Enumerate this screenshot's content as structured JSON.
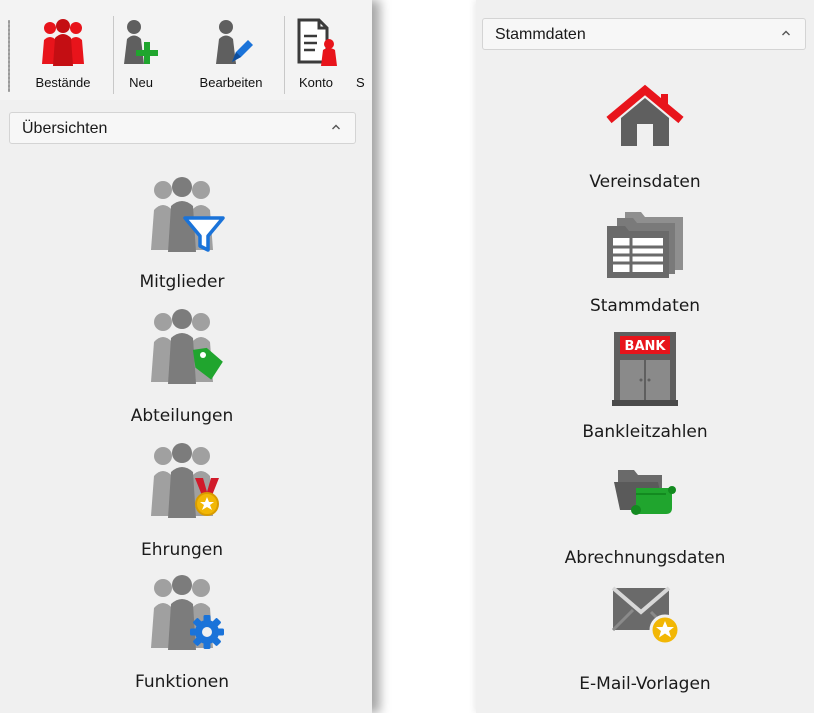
{
  "toolbar": {
    "buttons": [
      {
        "label": "Bestände",
        "icon": "members-red-icon"
      },
      {
        "label": "Neu",
        "icon": "new-member-icon"
      },
      {
        "label": "Bearbeiten",
        "icon": "edit-member-icon"
      },
      {
        "label": "Konto",
        "icon": "account-document-icon"
      },
      {
        "label": "S",
        "icon": ""
      }
    ]
  },
  "left_group": {
    "title": "Übersichten",
    "items": [
      {
        "label": "Mitglieder",
        "icon": "members-filter-icon"
      },
      {
        "label": "Abteilungen",
        "icon": "members-tag-icon"
      },
      {
        "label": "Ehrungen",
        "icon": "members-medal-icon"
      },
      {
        "label": "Funktionen",
        "icon": "members-gear-icon"
      }
    ]
  },
  "right_group": {
    "title": "Stammdaten",
    "items": [
      {
        "label": "Vereinsdaten",
        "icon": "house-icon"
      },
      {
        "label": "Stammdaten",
        "icon": "folder-table-icon"
      },
      {
        "label": "Bankleitzahlen",
        "icon": "bank-icon",
        "sign": "BANK"
      },
      {
        "label": "Abrechnungsdaten",
        "icon": "folder-scroll-icon"
      },
      {
        "label": "E-Mail-Vorlagen",
        "icon": "mail-star-icon"
      }
    ]
  },
  "colors": {
    "red": "#e8141b",
    "green": "#20a52e",
    "blue": "#1a73d9",
    "gray": "#8a8a8a",
    "panel": "#f0f0f0"
  }
}
